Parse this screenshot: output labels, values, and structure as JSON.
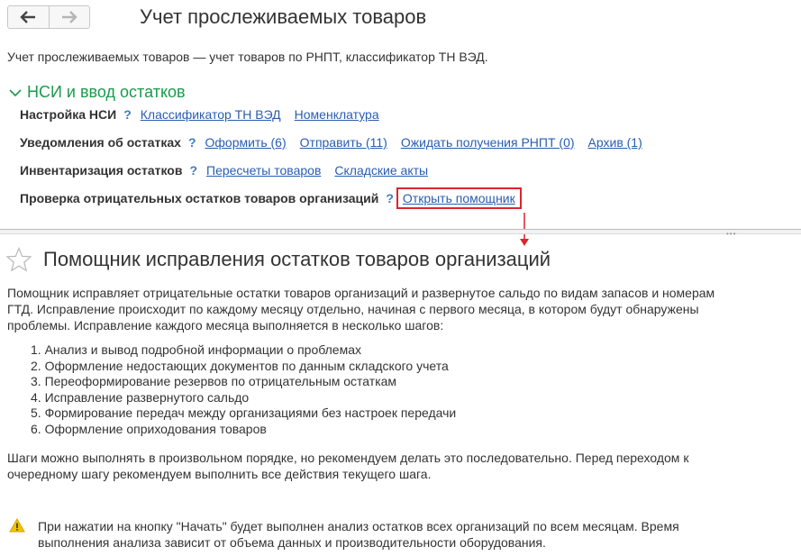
{
  "window": {
    "title": "Учет прослеживаемых товаров"
  },
  "intro": "Учет прослеживаемых товаров — учет товаров по РНПТ, классификатор ТН ВЭД.",
  "section": {
    "title": "НСИ и ввод остатков"
  },
  "rows": [
    {
      "label": "Настройка НСИ",
      "help": "?",
      "links": [
        "Классификатор ТН ВЭД",
        "Номенклатура"
      ]
    },
    {
      "label": "Уведомления об остатках",
      "help": "?",
      "links": [
        "Оформить (6)",
        "Отправить (11)",
        "Ожидать получения РНПТ (0)",
        "Архив (1)"
      ]
    },
    {
      "label": "Инвентаризация остатков",
      "help": "?",
      "links": [
        "Пересчеты товаров",
        "Складские акты"
      ]
    },
    {
      "label": "Проверка отрицательных остатков товаров организаций",
      "help": "?",
      "links": [
        "Открыть помощник"
      ]
    }
  ],
  "helper": {
    "title": "Помощник исправления остатков товаров организаций",
    "description_lines": [
      "Помощник исправляет отрицательные остатки товаров организаций и развернутое сальдо по видам запасов и номерам",
      "ГТД. Исправление происходит по каждому месяцу отдельно, начиная с первого месяца, в котором будут обнаружены",
      "проблемы. Исправление каждого месяца выполняется в несколько шагов:"
    ],
    "steps": [
      "1. Анализ и вывод подробной информации о проблемах",
      "2. Оформление недостающих документов по данным складского учета",
      "3. Переоформирование резервов по отрицательным остаткам",
      "4. Исправление развернутого сальдо",
      "5. Формирование передач между организациями без настроек передачи",
      "6. Оформление оприходования товаров"
    ],
    "note_lines": [
      "Шаги можно выполнять в произвольном порядке, но рекомендуем делать это последовательно. Перед переходом к",
      "очередному шагу рекомендуем выполнить все действия текущего шага."
    ],
    "warning_lines": [
      "При нажатии на кнопку \"Начать\" будет выполнен анализ остатков всех организаций по всем месяцам. Время",
      "выполнения анализа зависит от объема данных и производительности оборудования."
    ]
  },
  "colors": {
    "section_green": "#1a9b4b",
    "link_blue": "#2a5db0",
    "highlight_red": "#d9262c",
    "warning_yellow": "#f2c200"
  },
  "icons": [
    "back-arrow-icon",
    "forward-arrow-icon",
    "chevron-down-icon",
    "star-icon",
    "warning-icon",
    "down-arrow-icon"
  ]
}
